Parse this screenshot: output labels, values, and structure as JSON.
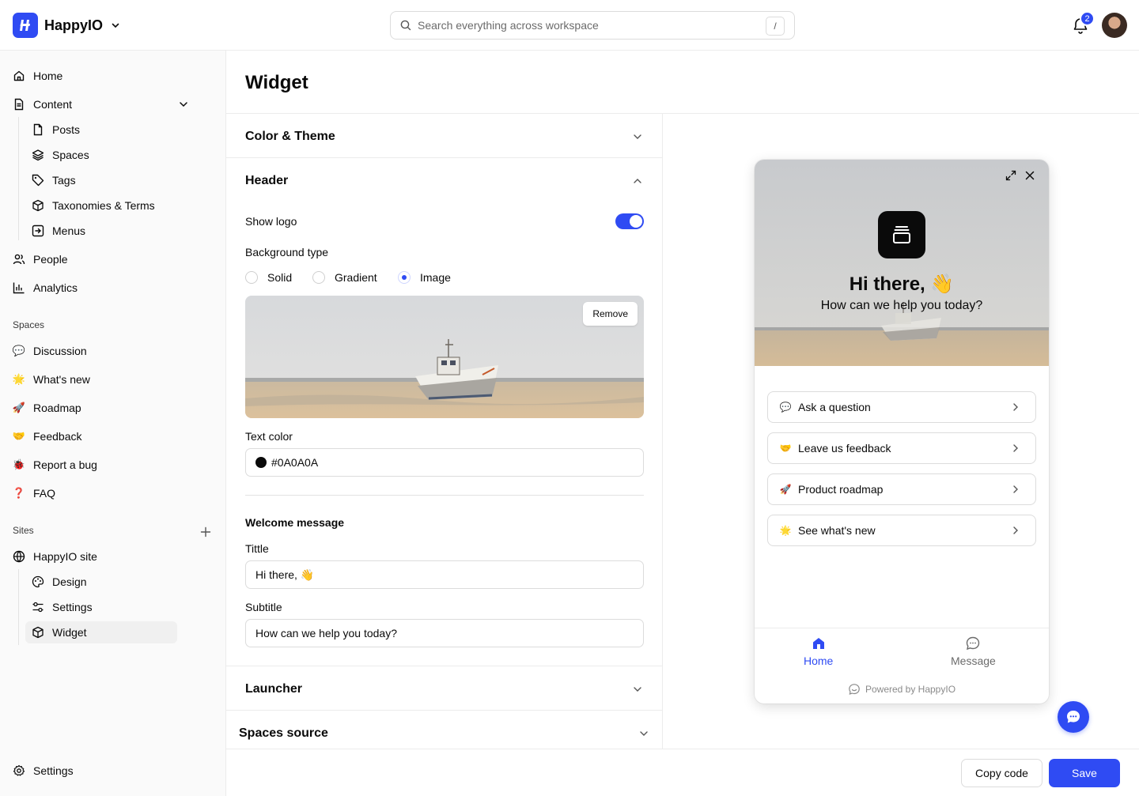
{
  "app": {
    "name": "HappyIO",
    "search_placeholder": "Search everything across workspace",
    "search_shortcut": "/",
    "notification_count": "2",
    "brand_color": "#2f4bf3"
  },
  "sidebar": {
    "main_items": [
      {
        "label": "Home",
        "icon": "home-icon"
      },
      {
        "label": "Content",
        "icon": "document-icon"
      },
      {
        "label": "Posts",
        "icon": "file-icon"
      },
      {
        "label": "Spaces",
        "icon": "layers-icon"
      },
      {
        "label": "Tags",
        "icon": "tag-icon"
      },
      {
        "label": "Taxonomies & Terms",
        "icon": "cube-icon"
      },
      {
        "label": "Menus",
        "icon": "menu-icon"
      },
      {
        "label": "People",
        "icon": "users-icon"
      },
      {
        "label": "Analytics",
        "icon": "chart-icon"
      }
    ],
    "spaces_heading": "Spaces",
    "spaces": [
      {
        "label": "Discussion",
        "icon": "💬"
      },
      {
        "label": "What's new",
        "icon": "🌟"
      },
      {
        "label": "Roadmap",
        "icon": "🚀"
      },
      {
        "label": "Feedback",
        "icon": "🤝"
      },
      {
        "label": "Report a bug",
        "icon": "🐞"
      },
      {
        "label": "FAQ",
        "icon": "❓"
      }
    ],
    "sites_heading": "Sites",
    "sites": [
      {
        "label": "HappyIO site",
        "icon": "globe-icon"
      },
      {
        "label": "Design",
        "icon": "palette-icon"
      },
      {
        "label": "Settings",
        "icon": "sliders-icon"
      },
      {
        "label": "Widget",
        "icon": "cube-icon"
      }
    ],
    "settings_label": "Settings"
  },
  "main": {
    "title": "Widget",
    "sections": {
      "color_theme": "Color & Theme",
      "header": "Header",
      "launcher": "Launcher",
      "spaces_source": "Spaces source"
    },
    "header_settings": {
      "show_logo_label": "Show logo",
      "show_logo_value": true,
      "background_type_label": "Background type",
      "background_options": [
        "Solid",
        "Gradient",
        "Image"
      ],
      "background_selected": "Image",
      "remove_label": "Remove",
      "text_color_label": "Text color",
      "text_color_value": "#0A0A0A",
      "welcome_heading": "Welcome message",
      "title_label": "Tittle",
      "title_value": "Hi there, 👋",
      "subtitle_label": "Subtitle",
      "subtitle_value": "How can we help you today?"
    }
  },
  "preview": {
    "greeting": "Hi there, 👋",
    "subtitle": "How can we help you today?",
    "items": [
      {
        "label": "Ask a question",
        "icon": "💬"
      },
      {
        "label": "Leave us feedback",
        "icon": "🤝"
      },
      {
        "label": "Product roadmap",
        "icon": "🚀"
      },
      {
        "label": "See what's new",
        "icon": "🌟"
      }
    ],
    "tabs": {
      "home": "Home",
      "message": "Message"
    },
    "powered_by": "Powered by HappyIO"
  },
  "footer": {
    "copy_code": "Copy code",
    "save": "Save"
  }
}
